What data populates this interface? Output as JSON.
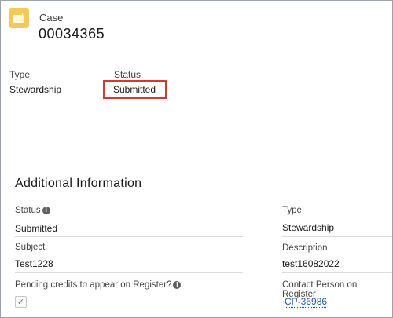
{
  "header": {
    "icon": "case-icon",
    "object_label": "Case",
    "record_number": "00034365"
  },
  "highlights": {
    "type_label": "Type",
    "type_value": "Stewardship",
    "status_label": "Status",
    "status_value": "Submitted",
    "highlight_color": "#d63a2f"
  },
  "section": {
    "title": "Additional Information",
    "left_fields": [
      {
        "label": "Status",
        "value": "Submitted",
        "info_icon": true
      },
      {
        "label": "Subject",
        "value": "Test1228",
        "info_icon": false
      },
      {
        "label": "Pending credits to appear on Register?",
        "value": "",
        "info_icon": true,
        "checkbox_checked": true
      }
    ],
    "right_fields": [
      {
        "label": "Type",
        "value": "Stewardship"
      },
      {
        "label": "Description",
        "value": "test16082022"
      },
      {
        "label": "Contact Person on Register",
        "value": "CP-36986",
        "is_link": true
      }
    ]
  },
  "colors": {
    "link": "#1b5bb3",
    "icon_bg": "#f4c859"
  }
}
